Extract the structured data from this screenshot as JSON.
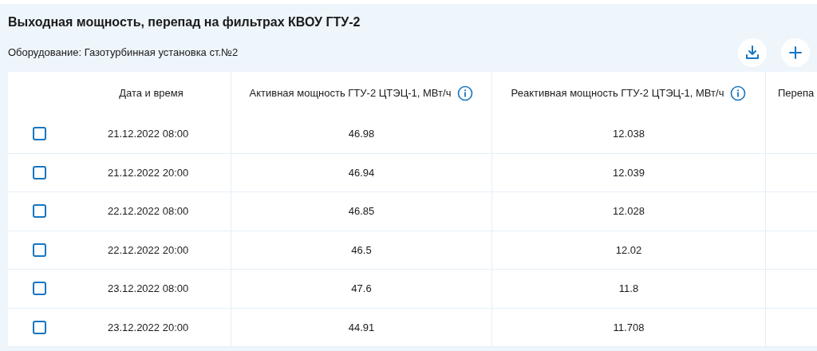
{
  "title": "Выходная мощность, перепад на фильтрах КВОУ ГТУ-2",
  "equipment": "Оборудование: Газотурбинная установка ст.№2",
  "columns": [
    {
      "label": "Дата и время",
      "info": false
    },
    {
      "label": "Активная мощность ГТУ-2 ЦТЭЦ-1, МВт/ч",
      "info": true
    },
    {
      "label": "Реактивная мощность ГТУ-2 ЦТЭЦ-1, МВт/ч",
      "info": true
    },
    {
      "label": "Перепа"
    }
  ],
  "rows": [
    {
      "checked": false,
      "cells": [
        "21.12.2022 08:00",
        "46.98",
        "12.038"
      ]
    },
    {
      "checked": false,
      "cells": [
        "21.12.2022 20:00",
        "46.94",
        "12.039"
      ]
    },
    {
      "checked": false,
      "cells": [
        "22.12.2022 08:00",
        "46.85",
        "12.028"
      ]
    },
    {
      "checked": false,
      "cells": [
        "22.12.2022 20:00",
        "46.5",
        "12.02"
      ]
    },
    {
      "checked": false,
      "cells": [
        "23.12.2022 08:00",
        "47.6",
        "11.8"
      ]
    },
    {
      "checked": false,
      "cells": [
        "23.12.2022 20:00",
        "44.91",
        "11.708"
      ]
    }
  ]
}
